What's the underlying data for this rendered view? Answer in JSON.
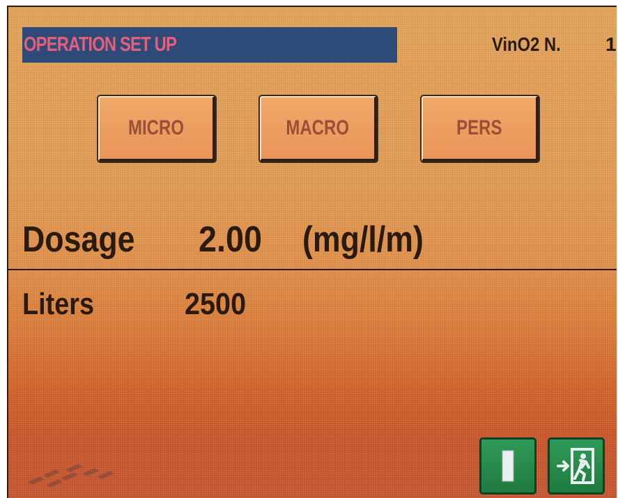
{
  "header": {
    "title": "OPERATION SET UP",
    "device_label": "VinO2 N.",
    "device_number": "1"
  },
  "modes": {
    "micro_label": "MICRO",
    "macro_label": "MACRO",
    "pers_label": "PERS"
  },
  "dosage": {
    "label": "Dosage",
    "value": "2.00",
    "unit": "(mg/l/m)"
  },
  "liters": {
    "label": "Liters",
    "value": "2500"
  },
  "footer": {
    "icons": [
      "info-bar-icon",
      "exit-door-icon",
      "brand-logo-icon"
    ]
  },
  "colors": {
    "title_bar_bg": "#2d4a79",
    "title_text": "#e4607a",
    "button_text": "#9a4f38",
    "action_button_green": "#2f9a57"
  }
}
